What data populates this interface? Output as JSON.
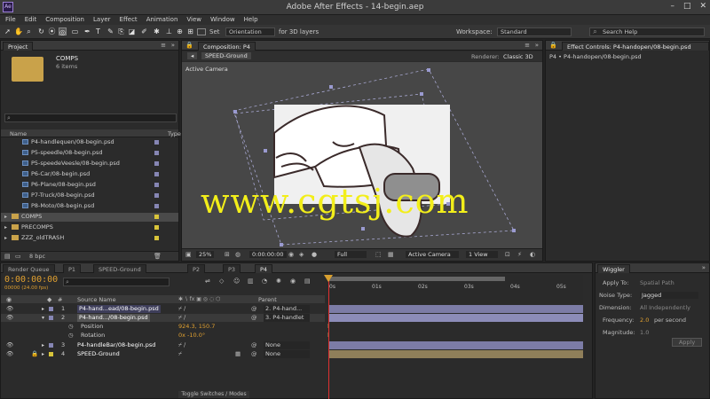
{
  "app": {
    "title": "Adobe After Effects - 14-begin.aep",
    "logo_label": "Ae",
    "window_controls": [
      "–",
      "□",
      "✕"
    ]
  },
  "menu": [
    "File",
    "Edit",
    "Composition",
    "Layer",
    "Effect",
    "Animation",
    "View",
    "Window",
    "Help"
  ],
  "toolbar": {
    "set_label": "Set",
    "orientation": "Orientation",
    "for3d_label": "for 3D layers",
    "workspace_label": "Workspace:",
    "workspace_value": "Standard",
    "search_placeholder": "Search Help"
  },
  "project": {
    "tab": "Project",
    "folder_name": "COMPS",
    "folder_count": "6 items",
    "search_placeholder": "",
    "col_name": "Name",
    "col_type": "Type",
    "items": [
      "P4-handlequen/08-begin.psd",
      "P5-speedle/08-begin.psd",
      "P5-speedeVeesle/08-begin.psd",
      "P6-Car/08-begin.psd",
      "P6-Plane/08-begin.psd",
      "P7-Truck/08-begin.psd",
      "P8-Moto/08-begin.psd"
    ],
    "folders": [
      "COMPS",
      "PRECOMPS",
      "ZZZ_oldTRASH"
    ],
    "bpc": "8 bpc"
  },
  "composition": {
    "tab": "Composition: P4",
    "breadcrumb": "SPEED-Ground",
    "renderer_label": "Renderer:",
    "renderer_value": "Classic 3D",
    "active_camera": "Active Camera",
    "zoom": "25%",
    "timecode": "0:00:00:00",
    "resolution": "Full",
    "view_select": "Active Camera",
    "views_count": "1 View"
  },
  "effect_controls": {
    "tab": "Effect Controls: P4-handopen/08-begin.psd",
    "subtitle": "P4 • P4-handopen/08-begin.psd"
  },
  "timeline": {
    "tabs": [
      "Render Queue",
      "P1",
      "SPEED-Ground",
      "P2",
      "P3",
      "P4"
    ],
    "timecode": "0:00:00:00",
    "frame_sub": "00000 (24.00 fps)",
    "col_source": "Source Name",
    "col_parent": "Parent",
    "ruler_marks": [
      "0s",
      "01s",
      "02s",
      "03s",
      "04s",
      "05s"
    ],
    "toggle_label": "Toggle Switches / Modes",
    "layers": [
      {
        "num": "1",
        "name": "P4-hand...ead/08-begin.psd",
        "parent": "2. P4-hand...",
        "color": "#8686b4"
      },
      {
        "num": "2",
        "name": "P4-hand.../08-begin.psd",
        "parent": "3. P4-handlet",
        "color": "#8686b4"
      },
      {
        "num": "3",
        "name": "P4-handleBar/08-begin.psd",
        "parent": "None",
        "color": "#8686b4"
      },
      {
        "num": "4",
        "name": "SPEED-Ground",
        "parent": "None",
        "color": "#d8c43a"
      }
    ],
    "props": [
      {
        "name": "Position",
        "value": "924.3, 150.7"
      },
      {
        "name": "Rotation",
        "value": "0x -10.0°"
      }
    ]
  },
  "wiggler": {
    "tab": "Wiggler",
    "apply_to_label": "Apply To:",
    "apply_to_value": "Spatial Path",
    "noise_label": "Noise Type:",
    "noise_value": "Jagged",
    "dimension_label": "Dimension:",
    "dimension_value": "All Independently",
    "frequency_label": "Frequency:",
    "frequency_value": "2.0",
    "frequency_unit": "per second",
    "magnitude_label": "Magnitude:",
    "magnitude_value": "1.0",
    "apply_button": "Apply"
  },
  "watermark": "www.cgtsj.com"
}
